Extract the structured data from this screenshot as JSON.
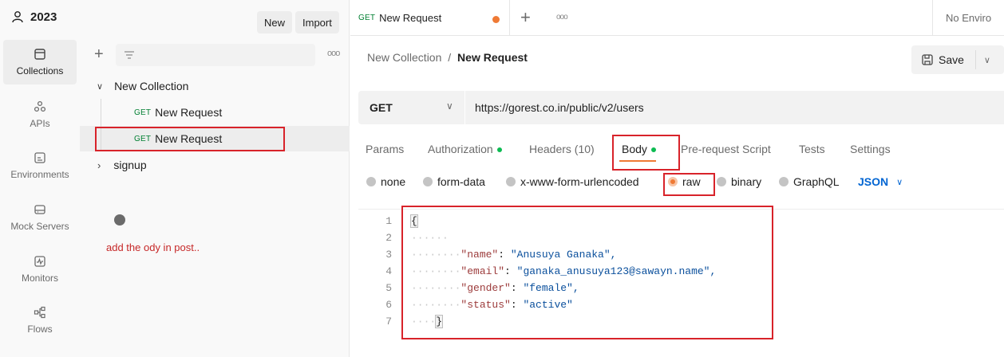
{
  "workspace": {
    "name": "2023",
    "new_label": "New",
    "import_label": "Import"
  },
  "rail": {
    "items": [
      {
        "label": "Collections",
        "icon": "collections-icon"
      },
      {
        "label": "APIs",
        "icon": "apis-icon"
      },
      {
        "label": "Environments",
        "icon": "environments-icon"
      },
      {
        "label": "Mock Servers",
        "icon": "mock-servers-icon"
      },
      {
        "label": "Monitors",
        "icon": "monitors-icon"
      },
      {
        "label": "Flows",
        "icon": "flows-icon"
      }
    ]
  },
  "tree": {
    "collection": "New Collection",
    "requests": [
      {
        "method": "GET",
        "name": "New Request"
      },
      {
        "method": "GET",
        "name": "New Request"
      }
    ],
    "folder": "signup"
  },
  "annotation": {
    "text": "add the ody in post.."
  },
  "tabbar": {
    "tab_method": "GET",
    "tab_name": "New Request",
    "env": "No Enviro"
  },
  "breadcrumb": {
    "collection": "New Collection",
    "sep": "/",
    "request": "New Request"
  },
  "save_label": "Save",
  "request": {
    "method": "GET",
    "url": "https://gorest.co.in/public/v2/users"
  },
  "request_tabs": {
    "params": "Params",
    "authorization": "Authorization",
    "headers": "Headers (10)",
    "body": "Body",
    "prerequest": "Pre-request Script",
    "tests": "Tests",
    "settings": "Settings"
  },
  "body_types": {
    "none": "none",
    "form_data": "form-data",
    "urlencoded": "x-www-form-urlencoded",
    "raw": "raw",
    "binary": "binary",
    "graphql": "GraphQL",
    "format": "JSON"
  },
  "editor": {
    "line_numbers": [
      "1",
      "2",
      "3",
      "4",
      "5",
      "6",
      "7"
    ],
    "open_brace": "{",
    "close_brace": "}",
    "fields": [
      {
        "key": "\"name\"",
        "value": "\"Anusuya Ganaka\","
      },
      {
        "key": "\"email\"",
        "value": "\"ganaka_anusuya123@sawayn.name\","
      },
      {
        "key": "\"gender\"",
        "value": "\"female\","
      },
      {
        "key": "\"status\"",
        "value": "\"active\""
      }
    ]
  },
  "colors": {
    "accent": "#ef7a35",
    "method_get": "#007f31",
    "annotation_red": "#d8232a",
    "json_blue": "#0265d2"
  }
}
